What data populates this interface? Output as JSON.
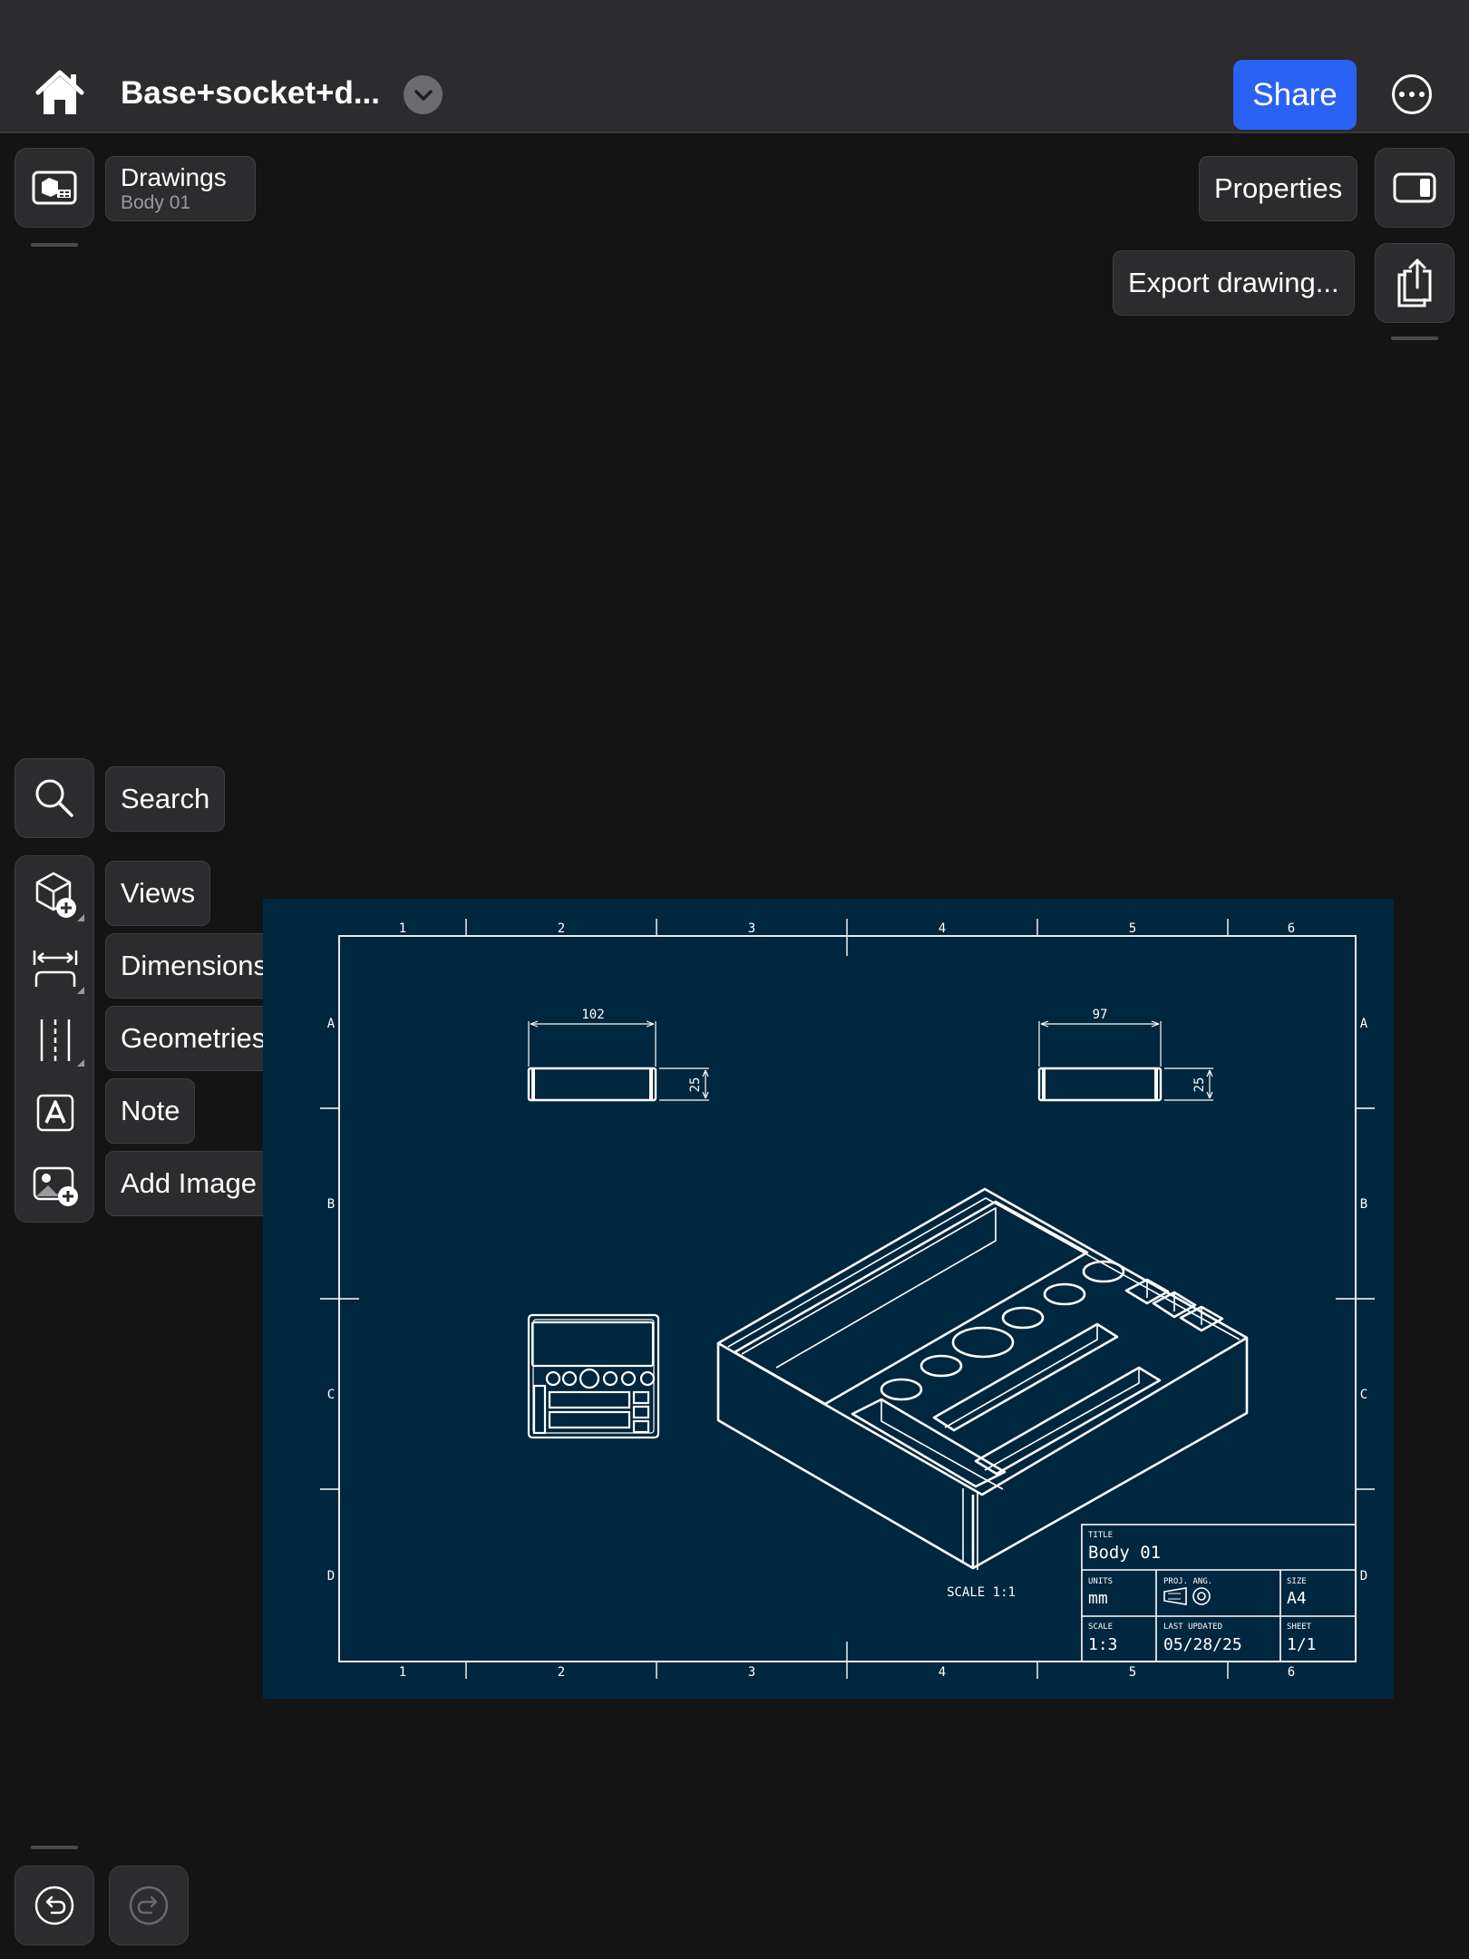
{
  "header": {
    "doc_title": "Base+socket+d...",
    "share_label": "Share"
  },
  "workspace": {
    "title": "Drawings",
    "subtitle": "Body 01"
  },
  "right_panel": {
    "properties_label": "Properties",
    "export_label": "Export drawing..."
  },
  "tools": {
    "search_label": "Search",
    "views_label": "Views",
    "dimensions_label": "Dimensions",
    "geometries_label": "Geometries",
    "note_label": "Note",
    "add_image_label": "Add Image"
  },
  "drawing": {
    "columns": [
      "1",
      "2",
      "3",
      "4",
      "5",
      "6"
    ],
    "rows": [
      "A",
      "B",
      "C",
      "D"
    ],
    "dim_width_left": "102",
    "dim_height_left": "25",
    "dim_width_right": "97",
    "dim_height_right": "25",
    "view_scale_label": "SCALE 1:1",
    "title_block": {
      "title_header": "TITLE",
      "title_value": "Body 01",
      "units_header": "UNITS",
      "units_value": "mm",
      "proj_header": "PROJ. ANG.",
      "size_header": "SIZE",
      "size_value": "A4",
      "scale_header": "SCALE",
      "scale_value": "1:3",
      "updated_header": "LAST UPDATED",
      "updated_value": "05/28/25",
      "sheet_header": "SHEET",
      "sheet_value": "1/1"
    }
  },
  "colors": {
    "accent": "#2a62f5",
    "canvas": "#01263f",
    "chrome": "#2c2c2e",
    "background": "#141414"
  },
  "icons": [
    "home-icon",
    "chevron-down-icon",
    "more-icon",
    "drawings-icon",
    "sidebar-toggle-icon",
    "share-export-icon",
    "search-icon",
    "views-add-icon",
    "dimensions-icon",
    "geometries-icon",
    "note-icon",
    "add-image-icon",
    "undo-icon",
    "redo-icon"
  ]
}
